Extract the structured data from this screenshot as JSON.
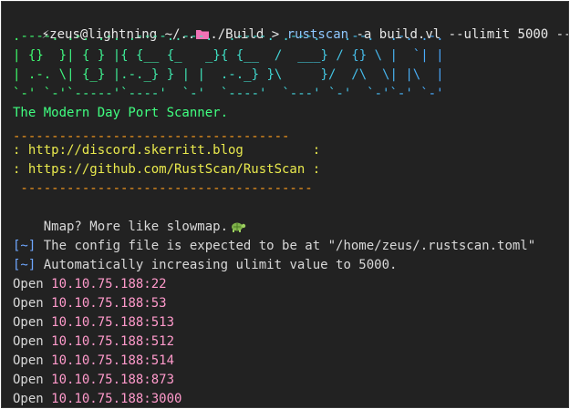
{
  "prompt": {
    "user_host": "zeus@lightning",
    "path_prefix": " ~/..",
    "path_suffix": "./Build",
    "separator": " > ",
    "command": "rustscan",
    "args": " -a build.vl --ulimit 5000 --"
  },
  "banner": {
    "lines": [
      ".----. .-. .-. .----..---.  .----. .---.   .--.  .-. .-.",
      "| {}  }| { } |{ {__ {_   _}{ {__  /  ___} / {} \\ |  `| |",
      "| .-. \\| {_} |.-._} } | |  .-._} }\\     }/  /\\  \\| |\\  |",
      "`-' `-'`-----'`----'  `-'  `----'  `---' `-'  `-'`-' `-'"
    ],
    "tagline": "The Modern Day Port Scanner."
  },
  "links_box": {
    "top_rule": "------------------------------------",
    "line1": ": http://discord.skerritt.blog         :",
    "line2": ": https://github.com/RustScan/RustScan :",
    "bottom_rule": " --------------------------------------"
  },
  "joke": "Nmap? More like slowmap.",
  "info": [
    {
      "tag": "[~]",
      "text": " The config file is expected to be at \"/home/zeus/.rustscan.toml\""
    },
    {
      "tag": "[~]",
      "text": " Automatically increasing ulimit value to 5000."
    }
  ],
  "open_ports": [
    {
      "label": "Open ",
      "addr": "10.10.75.188:22"
    },
    {
      "label": "Open ",
      "addr": "10.10.75.188:53"
    },
    {
      "label": "Open ",
      "addr": "10.10.75.188:513"
    },
    {
      "label": "Open ",
      "addr": "10.10.75.188:512"
    },
    {
      "label": "Open ",
      "addr": "10.10.75.188:514"
    },
    {
      "label": "Open ",
      "addr": "10.10.75.188:873"
    },
    {
      "label": "Open ",
      "addr": "10.10.75.188:3000"
    }
  ],
  "colors": {
    "background": "#222222",
    "banner_gradient": [
      "#3fff6a",
      "#3fe0c8",
      "#4aa8ff"
    ],
    "tagline": "#40ff80",
    "links": "#e9e94d",
    "rules": "#ff9d1c",
    "info_tag": "#6fa7ff",
    "ip": "#ff9acb"
  },
  "icons": {
    "prompt": "bolt-icon",
    "folder": "folder-icon",
    "joke": "turtle-icon"
  }
}
